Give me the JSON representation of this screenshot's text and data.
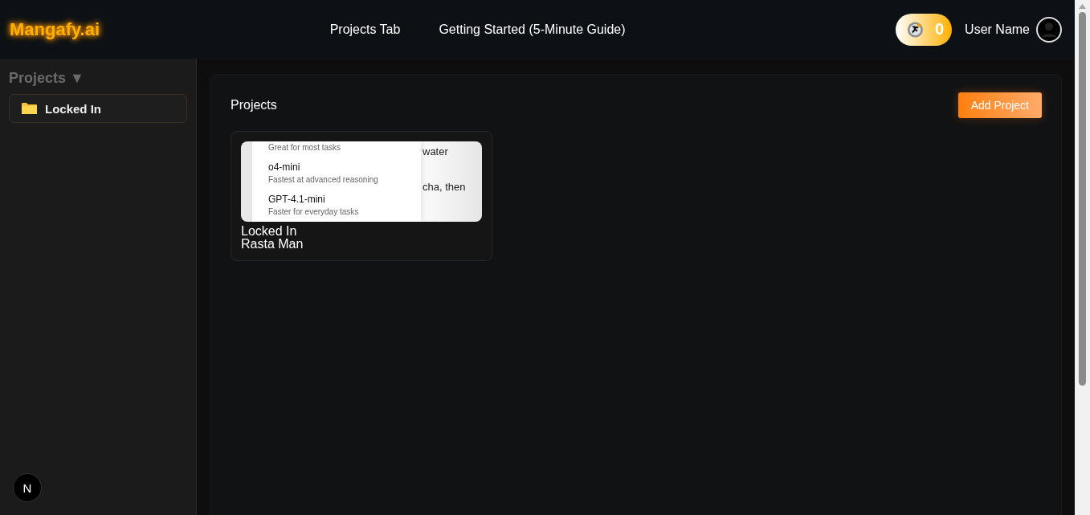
{
  "header": {
    "logo": "Mangafy.ai",
    "nav": [
      {
        "label": "Projects Tab"
      },
      {
        "label": "Getting Started (5-Minute Guide)"
      }
    ],
    "credits": "0",
    "user_name": "User Name"
  },
  "sidebar": {
    "heading": "Projects ▼",
    "items": [
      {
        "label": "Locked In"
      }
    ],
    "badge": "N"
  },
  "main": {
    "title": "Projects",
    "add_button": "Add Project",
    "projects": [
      {
        "preview": {
          "behind": [
            "water",
            "cha, then"
          ],
          "menu": [
            {
              "desc": "Great for most tasks"
            },
            {
              "name": "o4-mini",
              "desc": "Fastest at advanced reasoning"
            },
            {
              "name": "GPT-4.1-mini",
              "desc": "Faster for everyday tasks"
            }
          ]
        },
        "title": "Locked In",
        "subtitle": "Rasta Man"
      }
    ]
  }
}
